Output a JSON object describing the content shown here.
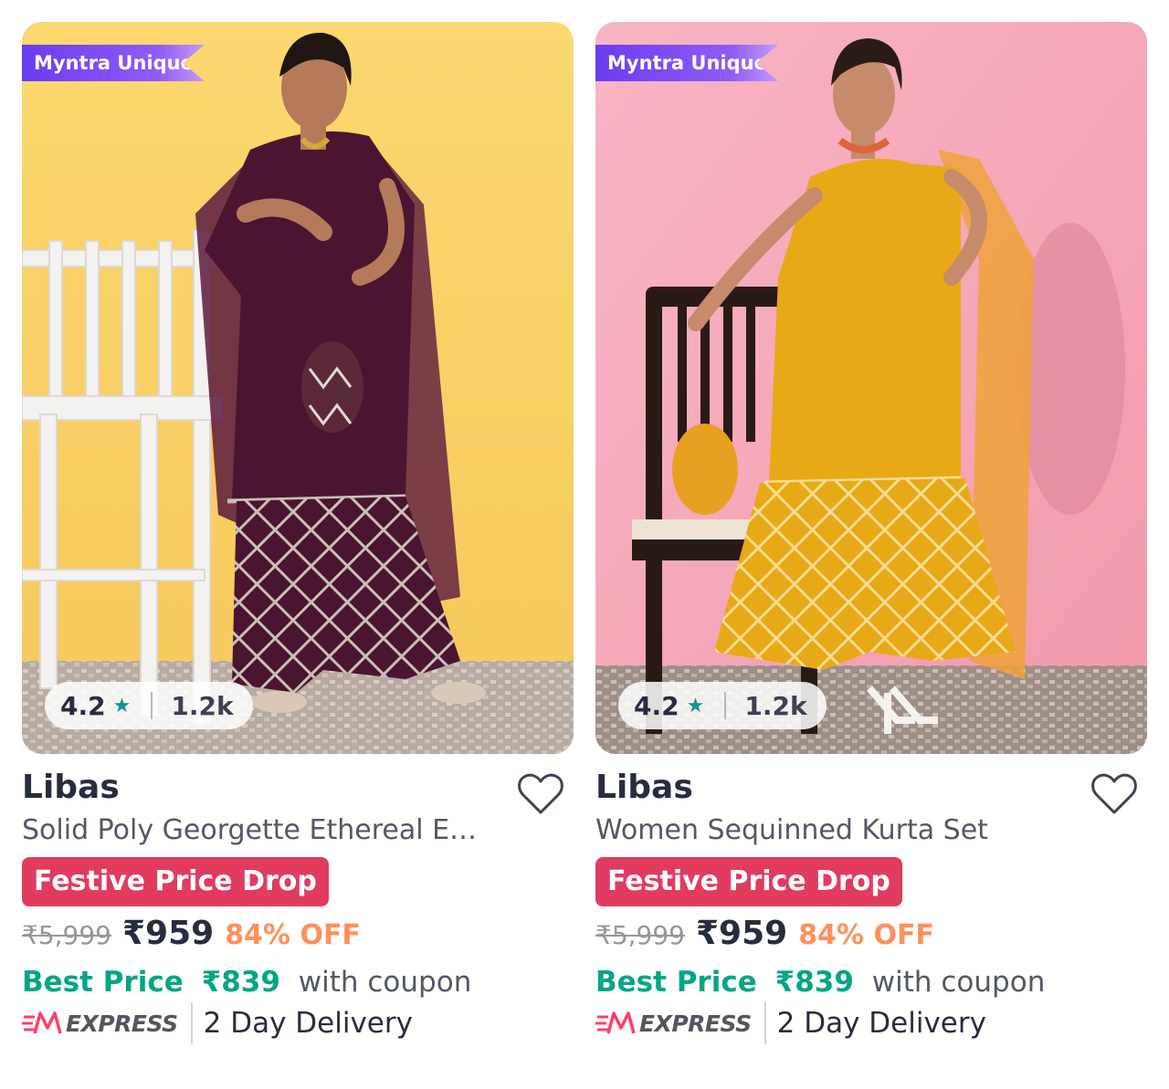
{
  "products": [
    {
      "tag": "Myntra Unique",
      "rating": "4.2",
      "rating_count": "1.2k",
      "brand": "Libas",
      "title": "Solid Poly Georgette Ethereal E…",
      "promo": "Festive Price Drop",
      "mrp": "₹5,999",
      "price": "₹959",
      "discount": "84% OFF",
      "best_price_label": "Best Price",
      "best_price": "₹839",
      "coupon_text": "with coupon",
      "express_label": "EXPRESS",
      "delivery": "2 Day Delivery",
      "background_color": "#fbd46a",
      "outfit_color": "#4a1530"
    },
    {
      "tag": "Myntra Unique",
      "rating": "4.2",
      "rating_count": "1.2k",
      "brand": "Libas",
      "title": "Women Sequinned Kurta Set",
      "promo": "Festive Price Drop",
      "mrp": "₹5,999",
      "price": "₹959",
      "discount": "84% OFF",
      "best_price_label": "Best Price",
      "best_price": "₹839",
      "coupon_text": "with coupon",
      "express_label": "EXPRESS",
      "delivery": "2 Day Delivery",
      "background_color": "#f5a9b9",
      "outfit_color": "#e8a917"
    }
  ],
  "colors": {
    "unique_tag": "#7b4bf4",
    "rating_star": "#14958f",
    "promo_badge": "#e13c5f",
    "discount": "#ff905a",
    "best_price": "#03a685",
    "express_logo": "#ff3f6c"
  },
  "icons": [
    "star-icon",
    "heart-icon",
    "myntra-m-express-logo"
  ]
}
